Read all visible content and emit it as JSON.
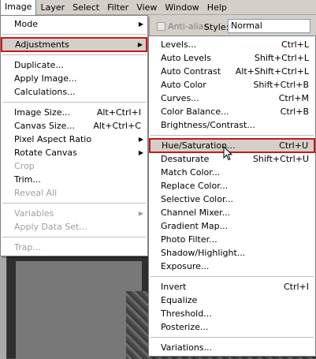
{
  "menubar": [
    "Image",
    "Layer",
    "Select",
    "Filter",
    "View",
    "Window",
    "Help"
  ],
  "options": {
    "antialias": "Anti-alias",
    "style_label": "Style:",
    "style_value": "Normal"
  },
  "image_menu": {
    "mode": "Mode",
    "adjustments": "Adjustments",
    "duplicate": "Duplicate...",
    "apply_image": "Apply Image...",
    "calculations": "Calculations...",
    "image_size": "Image Size...",
    "image_size_sc": "Alt+Ctrl+I",
    "canvas_size": "Canvas Size...",
    "canvas_size_sc": "Alt+Ctrl+C",
    "pixel_aspect": "Pixel Aspect Ratio",
    "rotate_canvas": "Rotate Canvas",
    "crop": "Crop",
    "trim": "Trim...",
    "reveal_all": "Reveal All",
    "variables": "Variables",
    "apply_data_set": "Apply Data Set...",
    "trap": "Trap..."
  },
  "adjustments_menu": [
    {
      "label": "Levels...",
      "shortcut": "Ctrl+L"
    },
    {
      "label": "Auto Levels",
      "shortcut": "Shift+Ctrl+L"
    },
    {
      "label": "Auto Contrast",
      "shortcut": "Alt+Shift+Ctrl+L"
    },
    {
      "label": "Auto Color",
      "shortcut": "Shift+Ctrl+B"
    },
    {
      "label": "Curves...",
      "shortcut": "Ctrl+M"
    },
    {
      "label": "Color Balance...",
      "shortcut": "Ctrl+B"
    },
    {
      "label": "Brightness/Contrast...",
      "shortcut": ""
    },
    {
      "label": "Hue/Saturation...",
      "shortcut": "Ctrl+U"
    },
    {
      "label": "Desaturate",
      "shortcut": "Shift+Ctrl+U"
    },
    {
      "label": "Match Color...",
      "shortcut": ""
    },
    {
      "label": "Replace Color...",
      "shortcut": ""
    },
    {
      "label": "Selective Color...",
      "shortcut": ""
    },
    {
      "label": "Channel Mixer...",
      "shortcut": ""
    },
    {
      "label": "Gradient Map...",
      "shortcut": ""
    },
    {
      "label": "Photo Filter...",
      "shortcut": ""
    },
    {
      "label": "Shadow/Highlight...",
      "shortcut": ""
    },
    {
      "label": "Exposure...",
      "shortcut": ""
    },
    {
      "label": "Invert",
      "shortcut": "Ctrl+I"
    },
    {
      "label": "Equalize",
      "shortcut": ""
    },
    {
      "label": "Threshold...",
      "shortcut": ""
    },
    {
      "label": "Posterize...",
      "shortcut": ""
    },
    {
      "label": "Variations...",
      "shortcut": ""
    }
  ],
  "colors": {
    "highlight_border": "#c8181e",
    "menu_bg": "#ffffff",
    "chrome": "#d4d0c8"
  }
}
